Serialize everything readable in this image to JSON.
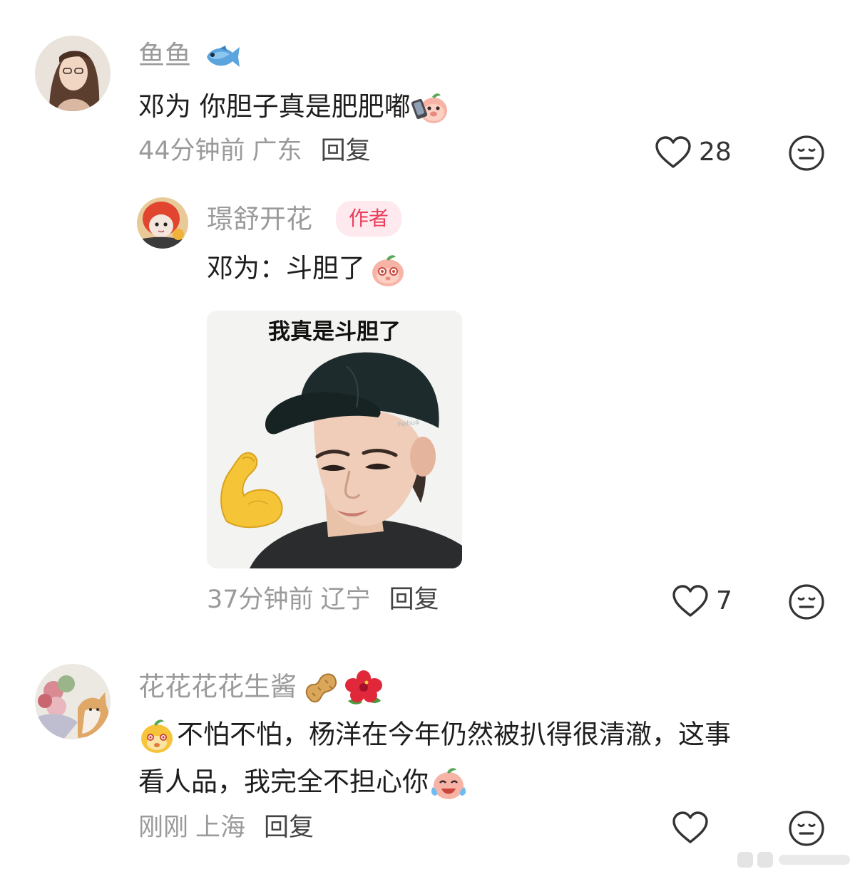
{
  "comments": [
    {
      "username": "鱼鱼",
      "username_icon": "fish-icon",
      "text": "邓为 你胆子真是肥肥嘟",
      "text_emoji": "pig-selfie-emoji",
      "time": "44分钟前",
      "location": "广东",
      "reply_label": "回复",
      "like_count": "28",
      "replies": [
        {
          "username": "璟舒开花",
          "badge": "作者",
          "text": "邓为：斗胆了",
          "text_emoji": "pig-face-emoji",
          "sticker_caption": "我真是斗胆了",
          "sticker_watermark": "Feihua",
          "time": "37分钟前",
          "location": "辽宁",
          "reply_label": "回复",
          "like_count": "7"
        }
      ]
    },
    {
      "username": "花花花花生酱",
      "username_icons": [
        "peanut-icon",
        "hibiscus-icon"
      ],
      "text_line1": "不怕不怕，杨洋在今年仍然被扒得很清澈，这事",
      "text_line2": "看人品，我完全不担心你",
      "time": "刚刚",
      "location": "上海",
      "reply_label": "回复",
      "like_count": ""
    }
  ],
  "colors": {
    "username": "#9a9a9a",
    "text": "#1e1e1e",
    "badge_bg": "#fde9ee",
    "badge_text": "#ea3d5b"
  }
}
